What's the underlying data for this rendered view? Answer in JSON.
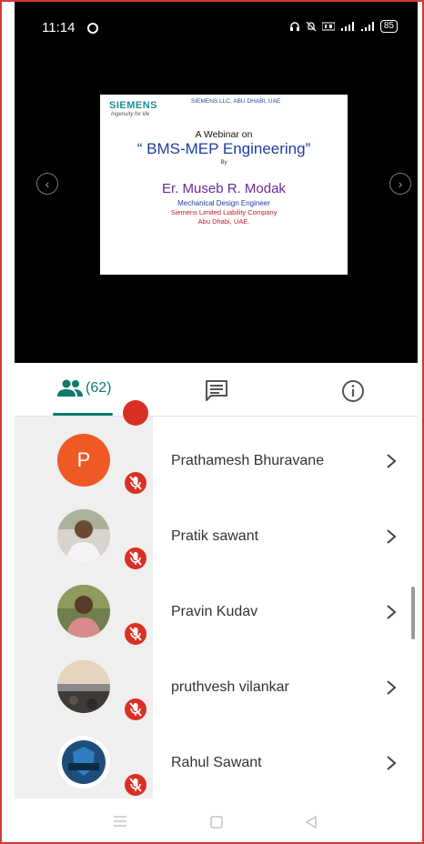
{
  "status_bar": {
    "time": "11:14",
    "icons": [
      "headset-icon",
      "mute-bell-icon",
      "volte-icon",
      "4g-signal-icon",
      "signal-icon"
    ],
    "battery": "85"
  },
  "slide": {
    "logo": "SIEMENS",
    "tagline": "Ingenuity for life",
    "header": "SIEMENS LLC, ABU DHABI, UAE",
    "line1": "A Webinar on",
    "title": "“ BMS-MEP Engineering”",
    "by": "By",
    "presenter": "Er. Museb R. Modak",
    "role": "Mechanical Design Engineer",
    "company": "Siemens Limited Liability Company",
    "city": "Abu Dhabi, UAE."
  },
  "tabs": {
    "people_count": "(62)",
    "active": "people"
  },
  "participants": [
    {
      "name": "Prathamesh Bhuravane",
      "avatar_letter": "P",
      "muted": true
    },
    {
      "name": "Pratik sawant",
      "avatar_letter": "",
      "muted": true
    },
    {
      "name": "Pravin Kudav",
      "avatar_letter": "",
      "muted": true
    },
    {
      "name": "pruthvesh vilankar",
      "avatar_letter": "",
      "muted": true
    },
    {
      "name": "Rahul Sawant",
      "avatar_letter": "",
      "muted": true
    }
  ],
  "colors": {
    "accent": "#0b7b6b",
    "mute_red": "#d93025",
    "avatar_orange": "#ef5a24",
    "frame_red": "#d23a35"
  }
}
